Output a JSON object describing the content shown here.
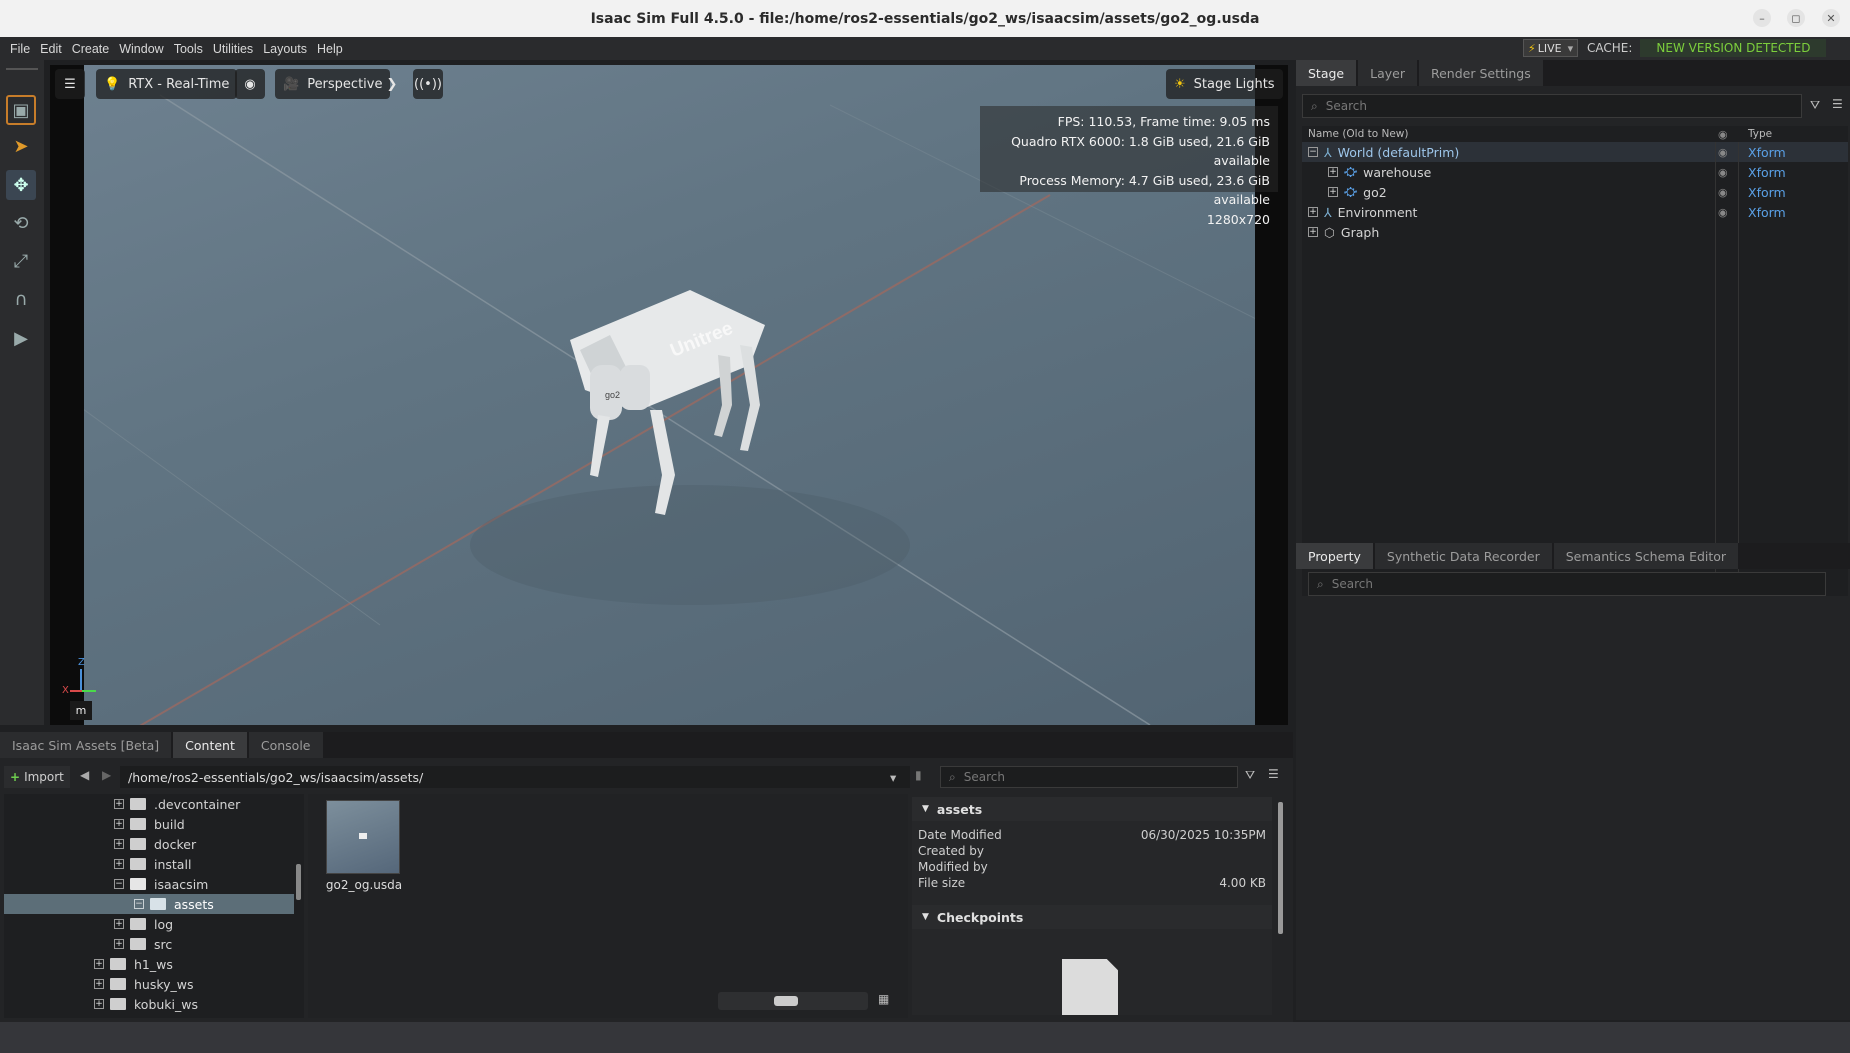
{
  "window": {
    "title": "Isaac Sim Full 4.5.0 - file:/home/ros2-essentials/go2_ws/isaacsim/assets/go2_og.usda",
    "minimize": "–",
    "maximize": "◻",
    "close": "✕"
  },
  "menubar": {
    "items": [
      "File",
      "Edit",
      "Create",
      "Window",
      "Tools",
      "Utilities",
      "Layouts",
      "Help"
    ],
    "live_label": "LIVE",
    "cache_label": "CACHE:",
    "cache_status": "NEW VERSION DETECTED"
  },
  "viewport": {
    "renderer": "RTX - Real-Time",
    "camera": "Perspective",
    "stage_lights": "Stage Lights",
    "stats": [
      "FPS: 110.53, Frame time: 9.05 ms",
      "Quadro RTX 6000: 1.8 GiB used, 21.6 GiB available",
      "Process Memory: 4.7 GiB used, 23.6 GiB available",
      "1280x720"
    ],
    "axis_z": "Z",
    "axis_x": "X",
    "unit": "m",
    "robot_brand": "Unitree",
    "robot_model": "go2"
  },
  "stage": {
    "tabs": [
      "Stage",
      "Layer",
      "Render Settings"
    ],
    "search_placeholder": "Search",
    "col_name": "Name (Old to New)",
    "col_type": "Type",
    "items": [
      {
        "name": "World (defaultPrim)",
        "type": "Xform"
      },
      {
        "name": "warehouse",
        "type": "Xform"
      },
      {
        "name": "go2",
        "type": "Xform"
      },
      {
        "name": "Environment",
        "type": "Xform"
      },
      {
        "name": "Graph",
        "type": ""
      }
    ]
  },
  "property": {
    "tabs": [
      "Property",
      "Synthetic Data Recorder",
      "Semantics Schema Editor"
    ],
    "search_placeholder": "Search"
  },
  "content": {
    "tabs": [
      "Isaac Sim Assets [Beta]",
      "Content",
      "Console"
    ],
    "import_label": "Import",
    "path": "/home/ros2-essentials/go2_ws/isaacsim/assets/",
    "search_placeholder": "Search",
    "tree": [
      ".devcontainer",
      "build",
      "docker",
      "install",
      "isaacsim",
      "assets",
      "log",
      "src",
      "h1_ws",
      "husky_ws",
      "kobuki_ws"
    ],
    "file_name": "go2_og.usda",
    "info": {
      "folder": "assets",
      "date_modified_label": "Date Modified",
      "date_modified": "06/30/2025 10:35PM",
      "created_by_label": "Created by",
      "modified_by_label": "Modified by",
      "file_size_label": "File size",
      "file_size": "4.00 KB",
      "checkpoints": "Checkpoints"
    }
  }
}
